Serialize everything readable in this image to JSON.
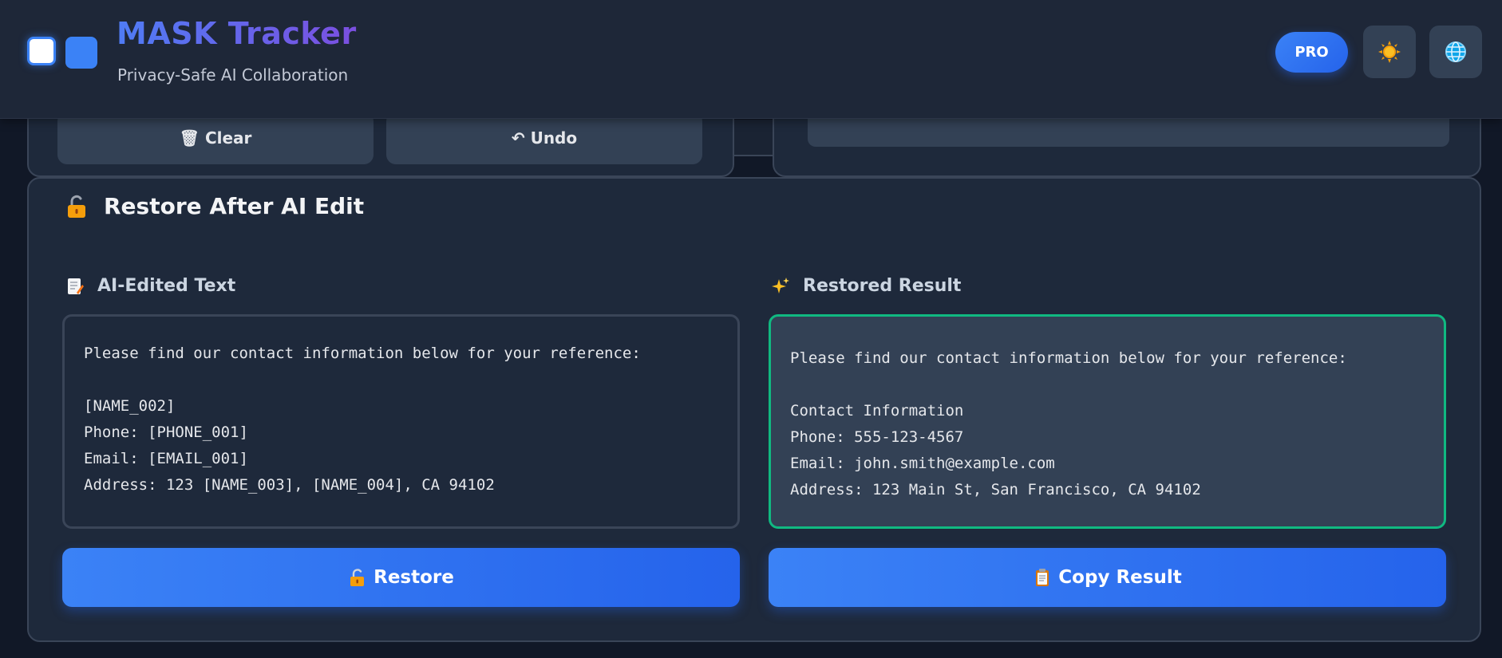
{
  "header": {
    "title": "MASK Tracker",
    "subtitle": "Privacy-Safe AI Collaboration",
    "pro_label": "PRO",
    "theme_icon": "sun-icon",
    "language_icon": "globe-icon"
  },
  "toolbar": {
    "clear_label": "🗑 Clear",
    "undo_label": "↶ Undo"
  },
  "restore_section": {
    "title": "Restore After AI Edit",
    "title_icon": "unlock-icon",
    "input_panel": {
      "label": "AI-Edited Text",
      "icon": "memo-icon",
      "text": "Please find our contact information below for your reference:\n\n[NAME_002]\nPhone: [PHONE_001]\nEmail: [EMAIL_001]\nAddress: 123 [NAME_003], [NAME_004], CA 94102"
    },
    "output_panel": {
      "label": "Restored Result",
      "icon": "sparkles-icon",
      "text": "Please find our contact information below for your reference:\n\nContact Information\nPhone: 555-123-4567\nEmail: john.smith@example.com\nAddress: 123 Main St, San Francisco, CA 94102"
    },
    "restore_button": "Restore",
    "copy_button": "Copy Result"
  },
  "colors": {
    "accent": "#3b82f6",
    "success_border": "#10b981",
    "background": "#111827",
    "card": "#1e293b"
  }
}
